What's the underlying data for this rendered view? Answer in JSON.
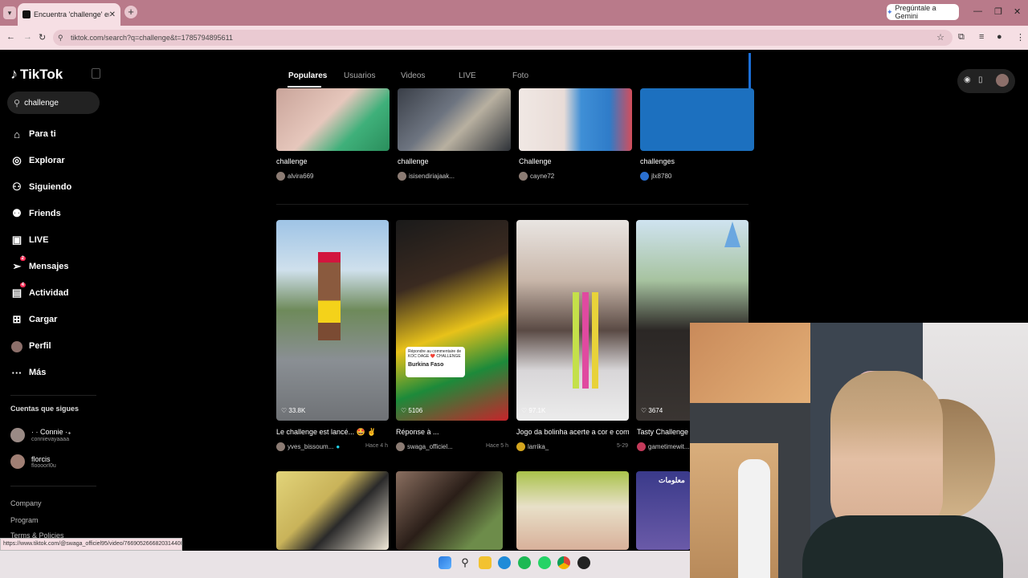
{
  "browser": {
    "tab_title": "Encuentra 'challenge' en TikTok",
    "url": "tiktok.com/search?q=challenge&t=1785794895611",
    "gemini_label": "Pregúntale a Gemini",
    "status_url": "https://www.tiktok.com/@swaga_officiel95/video/7669052666820314400"
  },
  "sidebar": {
    "logo": "TikTok",
    "search_value": "challenge",
    "nav": [
      {
        "label": "Para ti",
        "icon": "home-icon"
      },
      {
        "label": "Explorar",
        "icon": "compass-icon"
      },
      {
        "label": "Siguiendo",
        "icon": "following-icon"
      },
      {
        "label": "Friends",
        "icon": "friends-icon"
      },
      {
        "label": "LIVE",
        "icon": "live-icon"
      },
      {
        "label": "Mensajes",
        "icon": "messages-icon",
        "badge": "2"
      },
      {
        "label": "Actividad",
        "icon": "activity-icon",
        "badge": "4"
      },
      {
        "label": "Cargar",
        "icon": "upload-icon"
      },
      {
        "label": "Perfil",
        "icon": "avatar"
      },
      {
        "label": "Más",
        "icon": "more-icon"
      }
    ],
    "following_title": "Cuentas que sigues",
    "accounts": [
      {
        "name": "· · Connie ·₊",
        "handle": "connievayaaaa"
      },
      {
        "name": "florcis",
        "handle": "floooorl0u"
      }
    ],
    "footer": [
      "Company",
      "Program",
      "Terms & Policies"
    ]
  },
  "search_tabs": [
    "Populares",
    "Usuarios",
    "Videos",
    "LIVE",
    "Foto"
  ],
  "row1": [
    {
      "caption": "challenge",
      "author": "alvira669"
    },
    {
      "caption": "challenge",
      "author": "isisendiriajaak..."
    },
    {
      "caption": "Challenge",
      "author": "cayne72"
    },
    {
      "caption": "challenges",
      "author": "jlx8780"
    }
  ],
  "row2": [
    {
      "likes": "♡ 33.8K",
      "caption": "Le challenge est lancé... 🤩 ✌",
      "author": "yves_bissoum...",
      "time": "Hace 4 h"
    },
    {
      "likes": "♡ 5106",
      "caption": "Réponse à ...",
      "author": "swaga_officiel...",
      "time": "Hace 5 h",
      "sticker_top": "Répondre au commentaire de KOC DAGE ❤️ CHALLENGE",
      "sticker_name": "Burkina Faso"
    },
    {
      "likes": "♡ 97.1K",
      "caption": "Jogo da bolinha acerte a cor e comp...",
      "author": "larrika_",
      "time": "5-29"
    },
    {
      "likes": "♡ 3674",
      "caption": "Tasty Challenge 🍩",
      "author": "gametimewit..."
    }
  ],
  "row3_overlay_text": "معلومات"
}
